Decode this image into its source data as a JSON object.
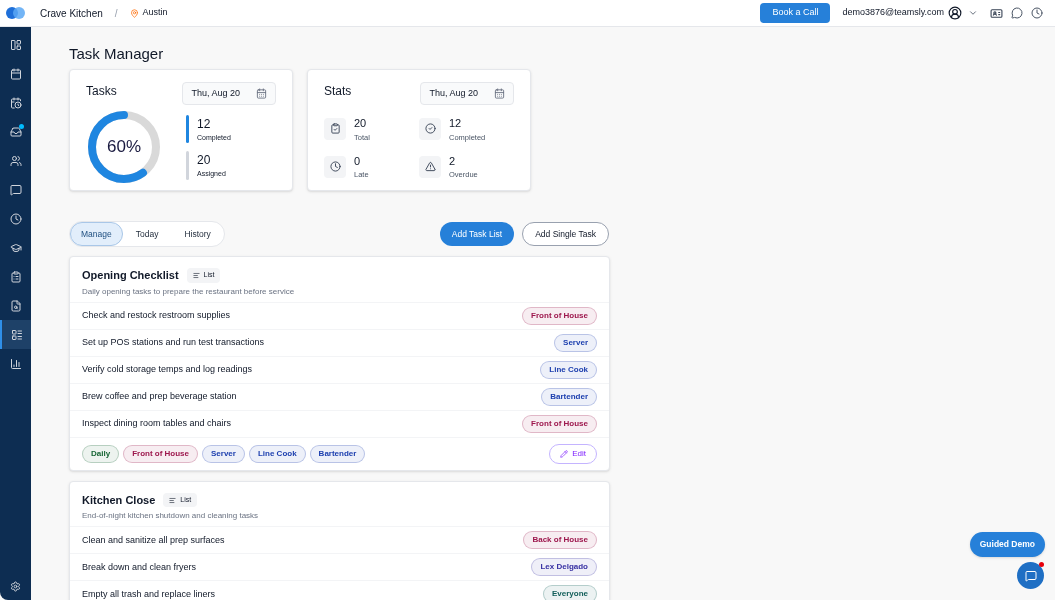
{
  "header": {
    "company": "Crave Kitchen",
    "separator": "/",
    "location": "Austin",
    "book_button": "Book a Call",
    "email": "demo3876@teamsly.com"
  },
  "sidebar": {
    "items": [
      {
        "selected": false,
        "badge": false
      },
      {
        "selected": false,
        "badge": false
      },
      {
        "selected": false,
        "badge": false
      },
      {
        "selected": false,
        "badge": true
      },
      {
        "selected": false,
        "badge": false
      },
      {
        "selected": false,
        "badge": false
      },
      {
        "selected": false,
        "badge": false
      },
      {
        "selected": false,
        "badge": false
      },
      {
        "selected": false,
        "badge": false
      },
      {
        "selected": false,
        "badge": false
      },
      {
        "selected": true,
        "badge": false
      },
      {
        "selected": false,
        "badge": false
      }
    ]
  },
  "page_title": "Task Manager",
  "tasks_card": {
    "title": "Tasks",
    "date": "Thu, Aug 20",
    "percent": "60%",
    "level": 0.6,
    "legend": [
      {
        "value": "12",
        "label": "Completed",
        "kind": "completed"
      },
      {
        "value": "20",
        "label": "Assigned",
        "kind": "assigned"
      }
    ]
  },
  "stats_card": {
    "title": "Stats",
    "date": "Thu, Aug 20",
    "stats": [
      {
        "kind": "total",
        "value": "20",
        "label": "Total"
      },
      {
        "kind": "completed",
        "value": "12",
        "label": "Completed"
      },
      {
        "kind": "late",
        "value": "0",
        "label": "Late"
      },
      {
        "kind": "overdue",
        "value": "2",
        "label": "Overdue"
      }
    ]
  },
  "tabs": [
    {
      "label": "Manage",
      "selected": true
    },
    {
      "label": "Today",
      "selected": false
    },
    {
      "label": "History",
      "selected": false
    }
  ],
  "actions": {
    "primary": "Add Task List",
    "secondary": "Add Single Task"
  },
  "task_lists": [
    {
      "title": "Opening Checklist",
      "badge": "List",
      "description": "Daily opening tasks to prepare the restaurant before service",
      "tasks": [
        {
          "name": "Check and restock restroom supplies",
          "tag": {
            "label": "Front of House",
            "color": "#9d174d"
          }
        },
        {
          "name": "Set up POS stations and run test transactions",
          "tag": {
            "label": "Server",
            "color": "#1e40af"
          }
        },
        {
          "name": "Verify cold storage temps and log readings",
          "tag": {
            "label": "Line Cook",
            "color": "#1e40af"
          }
        },
        {
          "name": "Brew coffee and prep beverage station",
          "tag": {
            "label": "Bartender",
            "color": "#1e40af"
          }
        },
        {
          "name": "Inspect dining room tables and chairs",
          "tag": {
            "label": "Front of House",
            "color": "#9d174d"
          }
        }
      ],
      "footer_tags": [
        {
          "label": "Daily",
          "color": "#166534"
        },
        {
          "label": "Front of House",
          "color": "#9d174d"
        },
        {
          "label": "Server",
          "color": "#1e40af"
        },
        {
          "label": "Line Cook",
          "color": "#1e40af"
        },
        {
          "label": "Bartender",
          "color": "#1e40af"
        }
      ],
      "edit": "Edit"
    },
    {
      "title": "Kitchen Close",
      "badge": "List",
      "description": "End-of-night kitchen shutdown and cleaning tasks",
      "tasks": [
        {
          "name": "Clean and sanitize all prep surfaces",
          "tag": {
            "label": "Back of House",
            "color": "#9d174d"
          }
        },
        {
          "name": "Break down and clean fryers",
          "tag": {
            "label": "Lex Delgado",
            "color": "#3730a3"
          }
        },
        {
          "name": "Empty all trash and replace liners",
          "tag": {
            "label": "Everyone",
            "color": "#115e59"
          }
        }
      ]
    }
  ],
  "guided_demo": "Guided Demo",
  "chat": {
    "unread": true
  }
}
